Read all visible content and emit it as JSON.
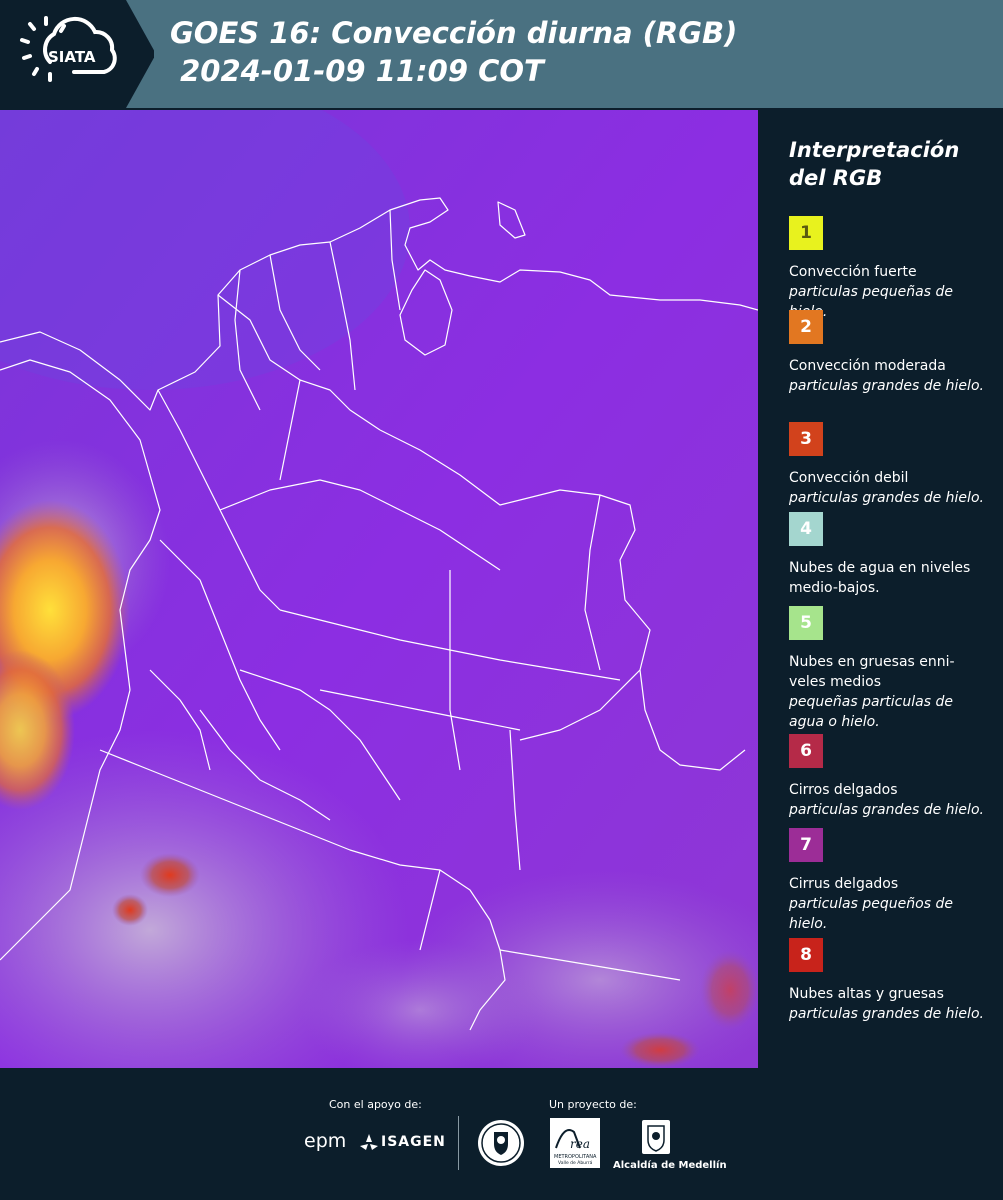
{
  "header": {
    "logo_text": "SIATA",
    "title_line1": "GOES 16: Convección diurna (RGB)",
    "title_line2": " 2024-01-09 11:09 COT"
  },
  "legend": {
    "title": "Interpretación del RGB",
    "items": [
      {
        "number": "1",
        "color": "#e8f21e",
        "number_color": "#5a5a10",
        "title": "Convección fuerte",
        "subtitle": "particulas pequeñas de hielo."
      },
      {
        "number": "2",
        "color": "#e27721",
        "number_color": "#ffffff",
        "title": "Convección moderada",
        "subtitle": "particulas grandes de hielo."
      },
      {
        "number": "3",
        "color": "#d2421c",
        "number_color": "#ffffff",
        "title": "Convección debil",
        "subtitle": "particulas grandes de hielo."
      },
      {
        "number": "4",
        "color": "#a4d6cf",
        "number_color": "#ffffff",
        "title": "Nubes de agua en niveles medio-bajos.",
        "subtitle": ""
      },
      {
        "number": "5",
        "color": "#a6e48c",
        "number_color": "#ffffff",
        "title": "Nubes en gruesas enni-veles medios",
        "subtitle": "pequeñas particulas de agua o hielo."
      },
      {
        "number": "6",
        "color": "#b52a48",
        "number_color": "#ffffff",
        "title": "Cirros delgados",
        "subtitle": "particulas grandes de hielo."
      },
      {
        "number": "7",
        "color": "#9c2d97",
        "number_color": "#ffffff",
        "title": "Cirrus delgados",
        "subtitle": "particulas pequeños de hielo."
      },
      {
        "number": "8",
        "color": "#c8231b",
        "number_color": "#ffffff",
        "title": "Nubes altas y gruesas",
        "subtitle": "particulas grandes de hielo."
      }
    ]
  },
  "footer": {
    "support_label": "Con el apoyo de:",
    "project_label": "Un proyecto de:",
    "sponsor_epm": "epm",
    "sponsor_isagen": "ISAGEN",
    "area_metropolitana_logo_text": "Área METROPOLITANA Valle de Aburrá",
    "alcaldia": "Alcaldía de Medellín"
  }
}
